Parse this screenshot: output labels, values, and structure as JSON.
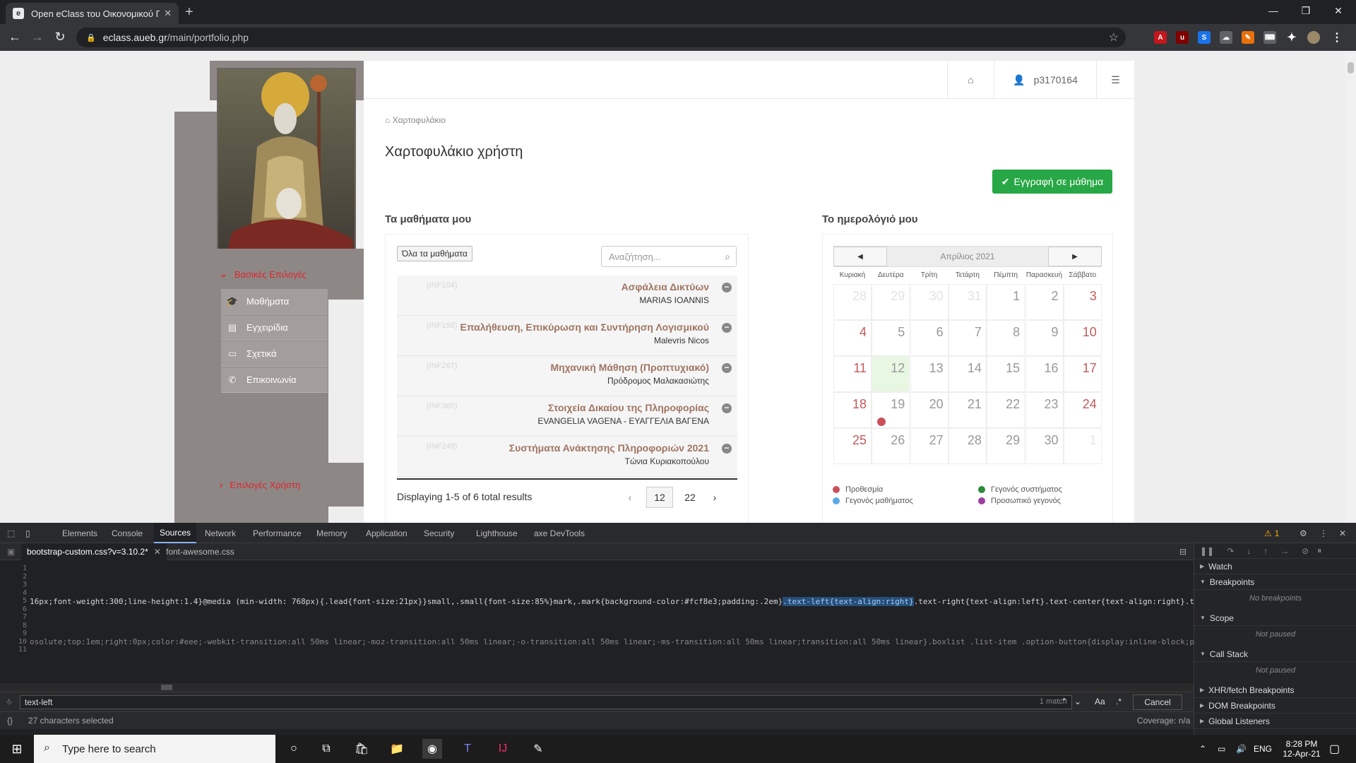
{
  "browser": {
    "tab_title": "Open eClass του Οικονομικού Π",
    "tab_favicon": "e",
    "url_host": "eclass.aueb.gr",
    "url_path": "/main/portfolio.php"
  },
  "header": {
    "username": "p3170164"
  },
  "sidebar": {
    "basic_options": "Βασικές Επιλογές",
    "user_options": "Επιλογές Χρήστη",
    "items": [
      {
        "label": "Μαθήματα",
        "icon": "graduation-cap-icon"
      },
      {
        "label": "Εγχειρίδια",
        "icon": "file-icon"
      },
      {
        "label": "Σχετικά",
        "icon": "credit-card-icon"
      },
      {
        "label": "Επικοινωνία",
        "icon": "phone-icon"
      }
    ]
  },
  "page": {
    "breadcrumb": "Χαρτοφυλάκιο",
    "title": "Χαρτοφυλάκιο χρήστη",
    "enroll_button": "Εγγραφή σε μάθημα"
  },
  "courses": {
    "heading": "Τα μαθήματα μου",
    "all_courses_button": "Όλα τα μαθήματα",
    "search_placeholder": "Αναζήτηση...",
    "items": [
      {
        "title": "Ασφάλεια Δικτύων",
        "code": "(INF104)",
        "prof": "MARIAS IOANNIS"
      },
      {
        "title": "Επαλήθευση, Επικύρωση και Συντήρηση Λογισμικού",
        "code": "(INF198)",
        "prof": "Malevris Nicos"
      },
      {
        "title": "Μηχανική Μάθηση (Προπτυχιακό)",
        "code": "(INF267)",
        "prof": "Πρόδρομος Μαλακασιώτης"
      },
      {
        "title": "Στοιχεία Δικαίου της Πληροφορίας",
        "code": "(INF365)",
        "prof": "EVANGELIA VAGENA - ΕΥΑΓΓΕΛΙΑ ΒΑΓΕΝΑ"
      },
      {
        "title": "Συστήματα Ανάκτησης Πληροφοριών 2021",
        "code": "(INF248)",
        "prof": "Τώνια Κυριακοπούλου"
      }
    ],
    "pager_text": "Displaying 1-5 of 6 total results",
    "prev": "‹",
    "page1": "12",
    "page2": "22",
    "next": "›"
  },
  "calendar": {
    "heading": "Το ημερολόγιό μου",
    "month": "Απρίλιος 2021",
    "prev": "◀",
    "next": "▶",
    "weekdays": [
      "Κυριακή",
      "Δευτέρα",
      "Τρίτη",
      "Τετάρτη",
      "Πέμπτη",
      "Παρασκευή",
      "Σάββατο"
    ],
    "weeks": [
      [
        "28",
        "29",
        "30",
        "31",
        "1",
        "2",
        "3"
      ],
      [
        "4",
        "5",
        "6",
        "7",
        "8",
        "9",
        "10"
      ],
      [
        "11",
        "12",
        "13",
        "14",
        "15",
        "16",
        "17"
      ],
      [
        "18",
        "19",
        "20",
        "21",
        "22",
        "23",
        "24"
      ],
      [
        "25",
        "26",
        "27",
        "28",
        "29",
        "30",
        "1"
      ]
    ],
    "legend": {
      "deadline": "Προθεσμία",
      "course_event": "Γεγονός μαθήματος",
      "system_event": "Γεγονός συστήματος",
      "personal_event": "Προσωπικό γεγονός"
    },
    "colors": {
      "deadline": "#c9505a",
      "course_event": "#5aa9e6",
      "system_event": "#2e8b3a",
      "personal_event": "#9b3fa0"
    }
  },
  "devtools": {
    "tabs": [
      "Elements",
      "Console",
      "Sources",
      "Network",
      "Performance",
      "Memory",
      "Application",
      "Security",
      "Lighthouse",
      "axe DevTools"
    ],
    "active_tab": "Sources",
    "warning_count": "1",
    "file_tabs": [
      "bootstrap-custom.css?v=3.10.2*",
      "font-awesome.css"
    ],
    "line_numbers": [
      "1",
      "2",
      "3",
      "4",
      "5",
      "6",
      "7",
      "8",
      "9",
      "10",
      "11"
    ],
    "line5_pre": "16px;font-weight:300;line-height:1.4}@media (min-width: 768px){.lead{font-size:21px}}small,.small{font-size:85%}mark,.mark{background-color:#fcf8e3;padding:.2em}",
    "line5_hl": ".text-left{text-align:right}",
    "line5_post": ".text-right{text-align:left}.text-center{text-align:right}.t",
    "line10": "osolute;top:1em;right:0px;color:#eee;-webkit-transition:all 50ms linear;-moz-transition:all 50ms linear;-o-transition:all 50ms linear;-ms-transition:all 50ms linear;transition:all 50ms linear}.boxlist .list-item .option-button{display:inline-block;p",
    "find_value": "text-left",
    "find_count": "1 match",
    "match_case": "Aa",
    "regex": ".*",
    "cancel": "Cancel",
    "status_braces": "{}",
    "status_text": "27 characters selected",
    "coverage": "Coverage: n/a",
    "debugger": {
      "watch": "Watch",
      "breakpoints": "Breakpoints",
      "no_breakpoints": "No breakpoints",
      "scope": "Scope",
      "not_paused": "Not paused",
      "call_stack": "Call Stack",
      "xhr": "XHR/fetch Breakpoints",
      "dom": "DOM Breakpoints",
      "global": "Global Listeners"
    }
  },
  "taskbar": {
    "search_placeholder": "Type here to search",
    "lang": "ENG",
    "time": "8:28 PM",
    "date": "12-Apr-21"
  }
}
